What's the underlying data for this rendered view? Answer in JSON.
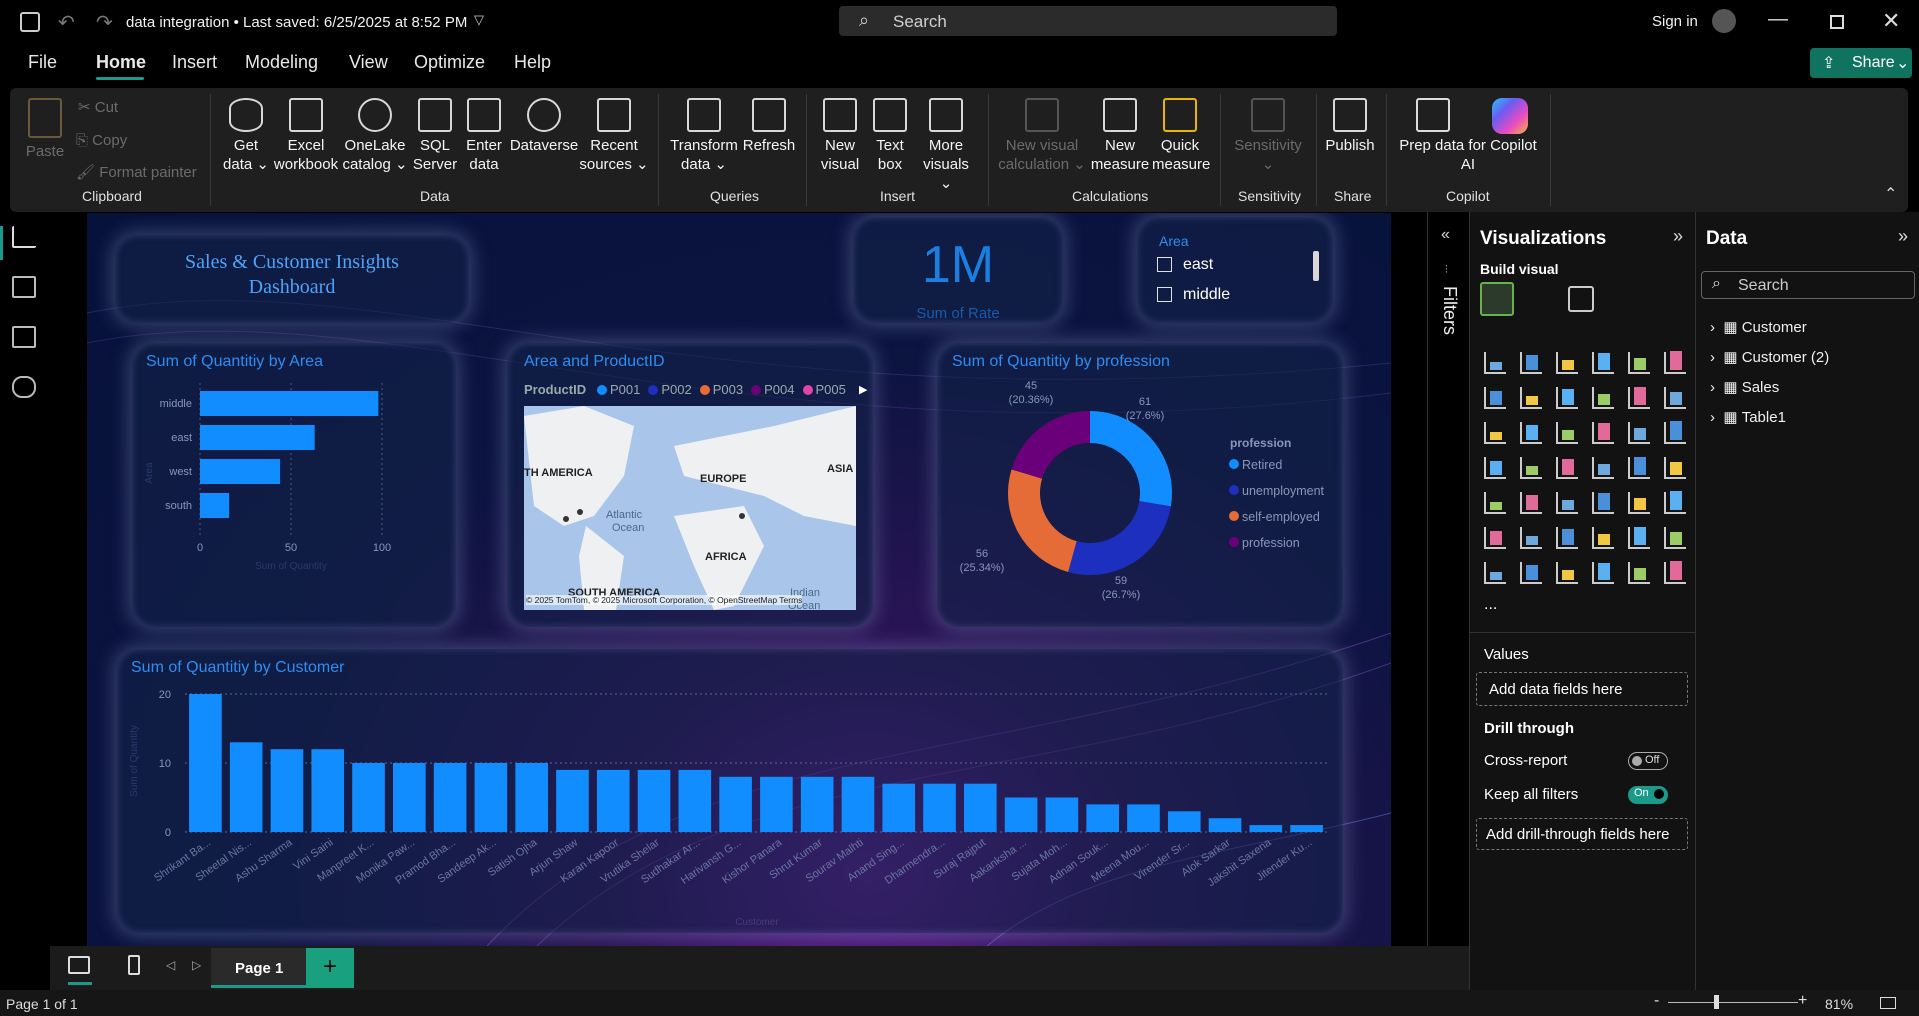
{
  "window": {
    "title": "data integration • Last saved: 6/25/2025 at 8:52 PM",
    "search_placeholder": "Search",
    "sign_in": "Sign in"
  },
  "menu": {
    "file": "File",
    "tabs": [
      "Home",
      "Insert",
      "Modeling",
      "View",
      "Optimize",
      "Help"
    ],
    "share": "Share"
  },
  "ribbon": {
    "clipboard": {
      "paste": "Paste",
      "cut": "Cut",
      "copy": "Copy",
      "format_painter": "Format painter",
      "label": "Clipboard"
    },
    "data": {
      "get_data": [
        "Get",
        "data ⌄"
      ],
      "excel": [
        "Excel",
        "workbook"
      ],
      "onelake": [
        "OneLake",
        "catalog ⌄"
      ],
      "sql": [
        "SQL",
        "Server"
      ],
      "enter": [
        "Enter",
        "data"
      ],
      "dataverse": [
        "Dataverse",
        ""
      ],
      "recent": [
        "Recent",
        "sources ⌄"
      ],
      "label": "Data"
    },
    "queries": {
      "transform": [
        "Transform",
        "data ⌄"
      ],
      "refresh": [
        "Refresh",
        ""
      ],
      "label": "Queries"
    },
    "insert": {
      "new_visual": [
        "New",
        "visual"
      ],
      "text_box": [
        "Text",
        "box"
      ],
      "more_visuals": [
        "More",
        "visuals ⌄"
      ],
      "label": "Insert"
    },
    "calculations": {
      "new_visual_calc": [
        "New visual",
        "calculation ⌄"
      ],
      "new_measure": [
        "New",
        "measure"
      ],
      "quick_measure": [
        "Quick",
        "measure"
      ],
      "label": "Calculations"
    },
    "sensitivity": {
      "btn": [
        "Sensitivity",
        "⌄"
      ],
      "label": "Sensitivity"
    },
    "share": {
      "publish": [
        "Publish",
        ""
      ],
      "label": "Share"
    },
    "copilot": {
      "prep": [
        "Prep data for Copilot",
        "AI"
      ],
      "label": "Copilot"
    }
  },
  "report": {
    "title_card": {
      "line1": "Sales & Customer Insights",
      "line2": "Dashboard"
    },
    "kpi": {
      "value": "1M",
      "label": "Sum of Rate"
    },
    "slicer": {
      "title": "Area",
      "items": [
        "east",
        "middle"
      ]
    },
    "area_chart_title": "Sum of Quantitiy by Area",
    "map": {
      "title": "Area and ProductID",
      "legend_title": "ProductID",
      "legend": [
        "P001",
        "P002",
        "P003",
        "P004",
        "P005"
      ],
      "labels": [
        "TH AMERICA",
        "EUROPE",
        "ASIA",
        "Atlantic",
        "Ocean",
        "AFRICA",
        "SOUTH AMERICA",
        "Indian",
        "Ocean"
      ],
      "attribution": "© 2025 TomTom, © 2025 Microsoft Corporation, © OpenStreetMap  Terms"
    },
    "donut_title": "Sum of Quantitiy by profession",
    "customer_chart_title": "Sum of Quantitiy by Customer"
  },
  "chart_data": [
    {
      "type": "bar",
      "orientation": "horizontal",
      "title": "Sum of Quantitiy by Area",
      "categories": [
        "middle",
        "east",
        "west",
        "south"
      ],
      "values": [
        98,
        63,
        44,
        16
      ],
      "xlim": [
        0,
        100
      ],
      "xticks": [
        "0",
        "50",
        "100"
      ],
      "xlabel": "Sum of Quantity",
      "ylabel": "Area",
      "color": "#118DFF"
    },
    {
      "type": "pie",
      "variant": "donut",
      "title": "Sum of Quantitiy by profession",
      "legend_title": "profession",
      "legend_position": "right",
      "categories": [
        "Retired",
        "unemployment",
        "self-employed",
        "profession"
      ],
      "values": [
        61,
        59,
        56,
        45
      ],
      "labels": [
        "61 (27.6%)",
        "59 (26.7%)",
        "56 (25.34%)",
        "45 (20.36%)"
      ],
      "colors": [
        "#118DFF",
        "#1D2FBF",
        "#E66C37",
        "#6B007B"
      ]
    },
    {
      "type": "bar",
      "title": "Sum of Quantitiy by Customer",
      "xlabel": "Customer",
      "ylabel": "Sum of Quantity",
      "ylim": [
        0,
        20
      ],
      "yticks": [
        "0",
        "10",
        "20"
      ],
      "categories": [
        "Shrikant Ba...",
        "Sheetal Nis...",
        "Ashu Sharma",
        "Vini Saini",
        "Manpreet K...",
        "Monika Paw...",
        "Pramod Bha...",
        "Sandeep Ak...",
        "Satish Ojha",
        "Arjun Shaw",
        "Karan Kapoor",
        "Vrutika Shelar",
        "Sudhakar Ar...",
        "Harivansh G...",
        "Kishor Panara",
        "Shrut Kumar",
        "Sourav Malhti",
        "Anand Sing...",
        "Dharmendra...",
        "Suraj Rajput",
        "Aakanksha ...",
        "Sujata Moh...",
        "Adnan Souk...",
        "Meena Mou...",
        "Virender Sr...",
        "Alok Sarkar",
        "Jakshit Saxena",
        "Jitender Ku..."
      ],
      "values": [
        20,
        13,
        12,
        12,
        10,
        10,
        10,
        10,
        10,
        9,
        9,
        9,
        9,
        8,
        8,
        8,
        8,
        7,
        7,
        7,
        5,
        5,
        4,
        4,
        3,
        2,
        1,
        1
      ],
      "color": "#118DFF"
    }
  ],
  "panes": {
    "filters": "Filters",
    "visualizations": {
      "title": "Visualizations",
      "build_visual": "Build visual",
      "values": "Values",
      "add_fields": "Add data fields here",
      "drill_through": "Drill through",
      "cross_report": "Cross-report",
      "cross_report_state": "Off",
      "keep_filters": "Keep all filters",
      "keep_filters_state": "On",
      "add_drill": "Add drill-through fields here",
      "more": "..."
    },
    "data": {
      "title": "Data",
      "search_placeholder": "Search",
      "tables": [
        "Customer",
        "Customer (2)",
        "Sales",
        "Table1"
      ]
    }
  },
  "bottom": {
    "page_tab": "Page 1",
    "add_page": "+",
    "page_status": "Page 1 of 1",
    "zoom": "81%"
  }
}
